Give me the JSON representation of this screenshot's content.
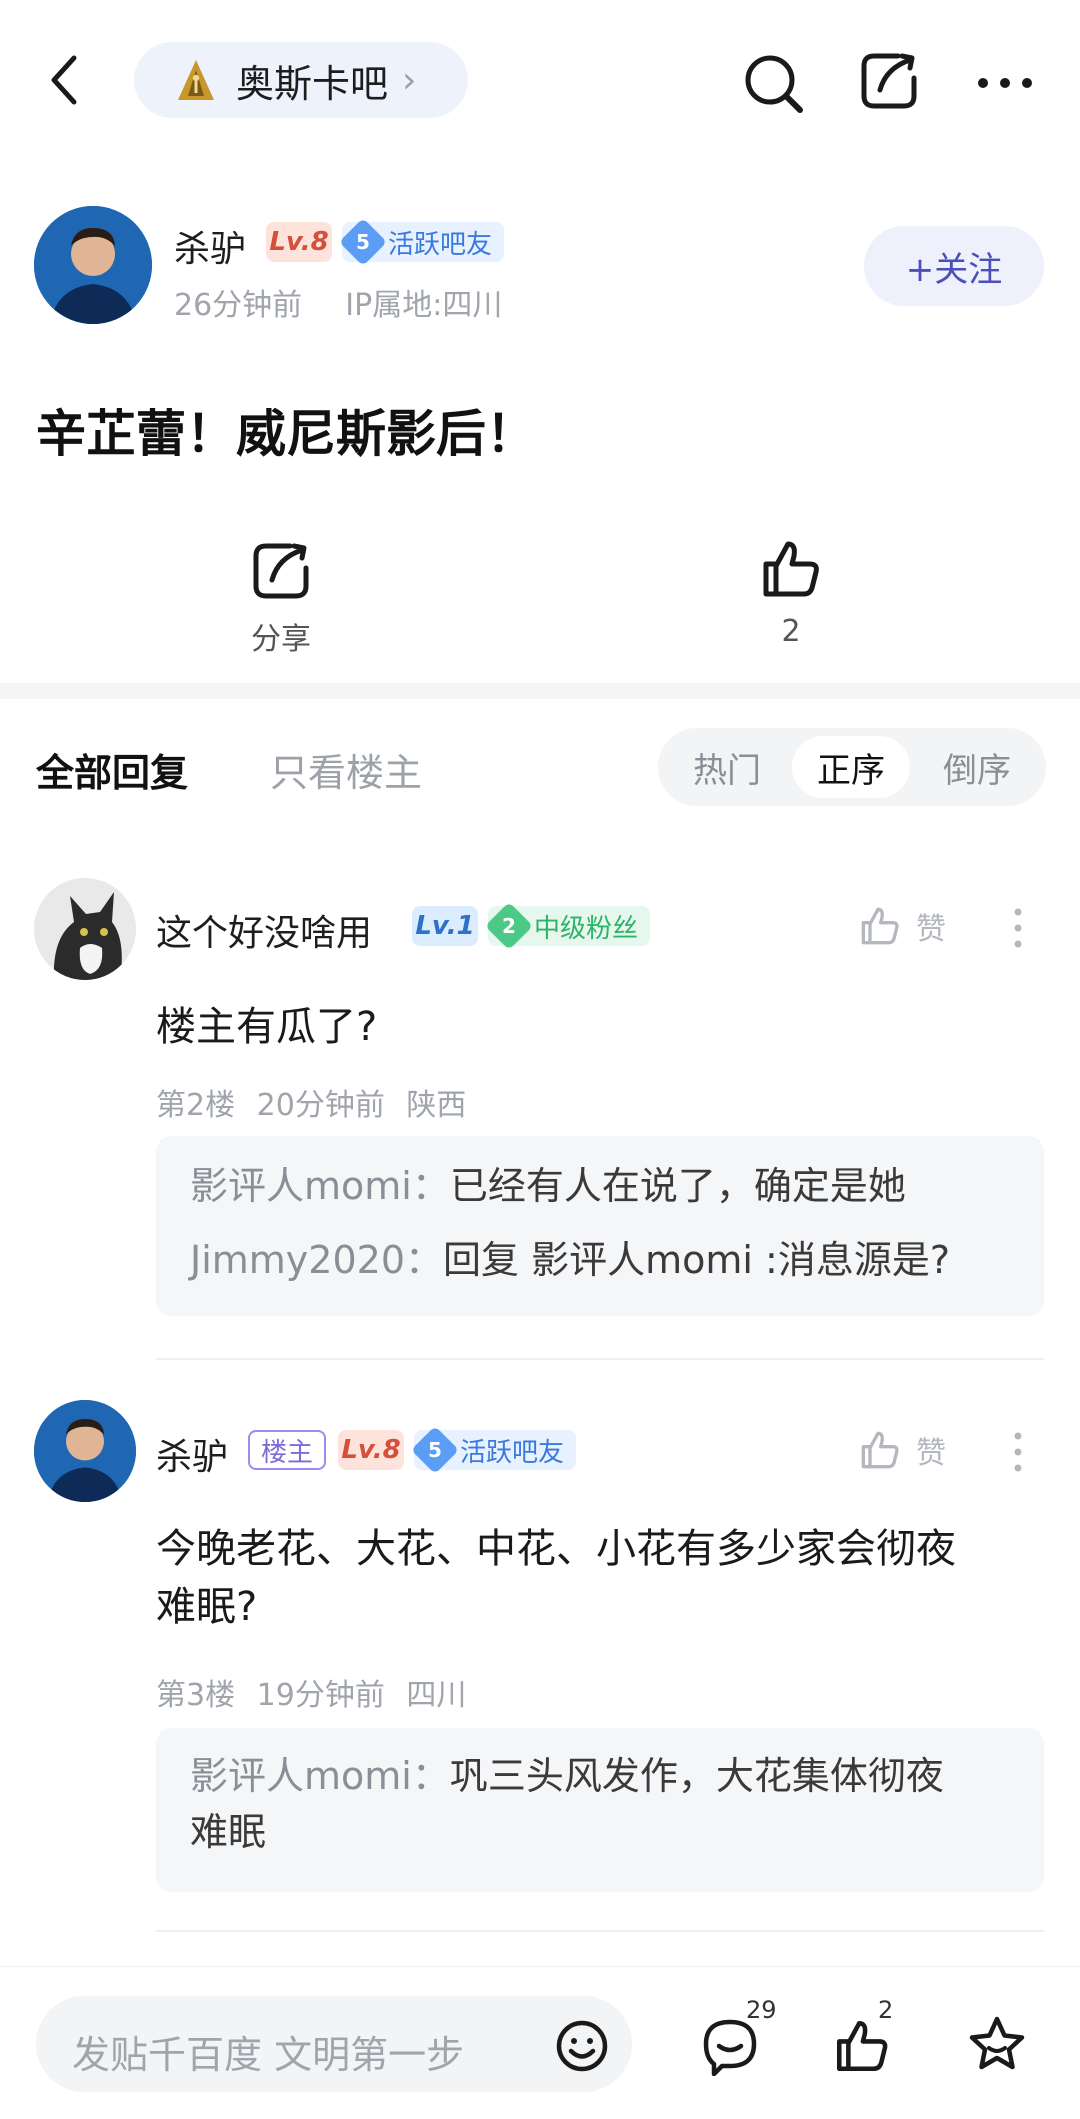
{
  "topbar": {
    "forum_name": "奥斯卡吧",
    "chevron": "›",
    "icons": [
      "back-icon",
      "search-icon",
      "share-icon",
      "more-icon"
    ]
  },
  "post": {
    "author": "杀驴",
    "level": "Lv.8",
    "fan_rank": "5",
    "fan_title": "活跃吧友",
    "time": "26分钟前",
    "ip": "IP属地:四川",
    "follow_label": "+关注",
    "title": "辛芷蕾！威尼斯影后！",
    "share_label": "分享",
    "like_count": "2"
  },
  "tabs": {
    "all_replies": "全部回复",
    "owner_only": "只看楼主",
    "sort": [
      "热门",
      "正序",
      "倒序"
    ],
    "sort_active_index": 1
  },
  "comments": [
    {
      "author": "这个好没啥用",
      "level": "Lv.1",
      "fan_rank": "2",
      "fan_title": "中级粉丝",
      "like_label": "赞",
      "text": "楼主有瓜了?",
      "floor": "第2楼",
      "time": "20分钟前",
      "location": "陕西",
      "replies": [
        {
          "author": "影评人momi",
          "sep": "：",
          "text": "已经有人在说了，确定是她"
        },
        {
          "author": "Jimmy2020",
          "sep": "：",
          "text": "回复 影评人momi :消息源是?"
        }
      ]
    },
    {
      "author": "杀驴",
      "host_badge": "楼主",
      "level": "Lv.8",
      "fan_rank": "5",
      "fan_title": "活跃吧友",
      "like_label": "赞",
      "text_line1": "今晚老花、大花、中花、小花有多少家会彻夜",
      "text_line2": "难眠?",
      "floor": "第3楼",
      "time": "19分钟前",
      "location": "四川",
      "replies": [
        {
          "author": "影评人momi",
          "sep": "：",
          "text_line1": "巩三头风发作，大花集体彻夜",
          "text_line2": "难眠"
        }
      ]
    }
  ],
  "bottom": {
    "input_placeholder": "发贴千百度 文明第一步",
    "comment_count": "29",
    "like_count": "2"
  },
  "colors": {
    "accent": "#4b4fb6",
    "level_red": "#d5503b",
    "fan_blue": "#3879e0",
    "fan_green": "#2fb36a"
  }
}
